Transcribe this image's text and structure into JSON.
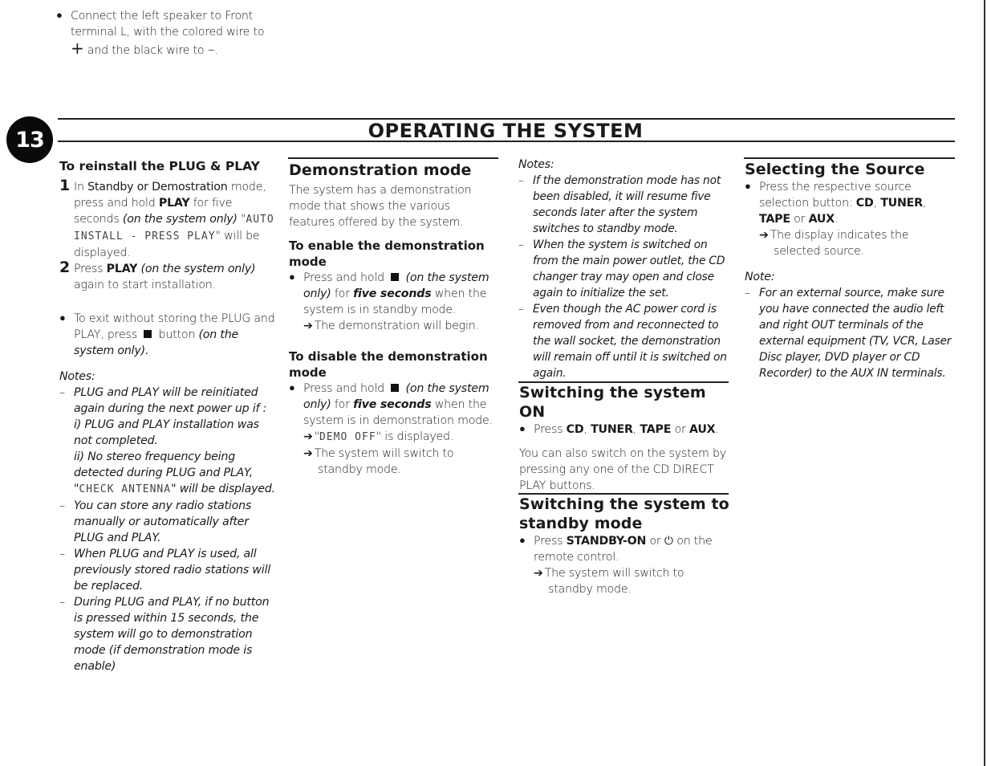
{
  "top_bullet": {
    "line1": "Connect the left speaker to Front",
    "line2": "terminal L, with the colored wire to",
    "plus_symbol": "+",
    "line3_mid": " and the black wire to ",
    "minus_symbol": "–",
    "line3_end": "."
  },
  "section": {
    "number": "13",
    "title": "OPERATING THE SYSTEM"
  },
  "col1": {
    "heading": "To reinstall the PLUG & PLAY",
    "step1": {
      "num": "1",
      "a": "In ",
      "b": "Standby or Demostration",
      "c": " mode, press and hold ",
      "d": "PLAY",
      "e": " for five seconds ",
      "f": "(on the system only)",
      "g": " \"",
      "lcd": "AUTO INSTALL - PRESS PLAY",
      "h": "\" will be displayed."
    },
    "step2": {
      "num": "2",
      "a": "Press ",
      "b": "PLAY",
      "c": " ",
      "d": "(on the system only)",
      "e": " again to start installation."
    },
    "exit_bullet": {
      "a": "To exit without storing the PLUG and PLAY, press ",
      "b": " button ",
      "c": "(on the system only)."
    },
    "notes_label": "Notes:",
    "notes": [
      {
        "a": "PLUG and PLAY will be reinitiated again during the next power up if :",
        "b": "i) PLUG and PLAY installation was not completed.",
        "c": "ii) No stereo frequency being detected during PLUG and PLAY, \"",
        "lcd": "CHECK ANTENNA",
        "d": "\" will be displayed."
      },
      {
        "text": "You can store any radio stations manually or automatically after PLUG and PLAY."
      },
      {
        "text": "When PLUG and PLAY is used, all previously stored radio stations will be replaced."
      },
      {
        "text": "During PLUG and PLAY, if no button is pressed within 15 seconds, the system will go to demonstration mode (if demonstration mode is enable)"
      }
    ]
  },
  "col2": {
    "heading": "Demonstration mode",
    "intro": "The system has a demonstration mode that shows the various features offered by the system.",
    "enable": {
      "heading": "To enable the demonstration mode",
      "a": "Press and hold ",
      "b": "(on the system only)",
      "c": " for ",
      "d": "five seconds",
      "e": " when the system is in standby mode.",
      "result": "The demonstration will begin."
    },
    "disable": {
      "heading": "To disable the demonstration mode",
      "a": "Press and hold ",
      "b": "(on the system only)",
      "c": " for ",
      "d": "five seconds",
      "e": " when the system is in demonstration mode.",
      "result1_a": "\"",
      "result1_lcd": "DEMO OFF",
      "result1_b": "\" is displayed.",
      "result2": "The system will switch to standby mode."
    }
  },
  "col3": {
    "notes_label": "Notes:",
    "notes": [
      "If the demonstration mode has not been disabled, it will resume five seconds later after the system switches to standby mode.",
      "When the system is switched on from the main power outlet, the CD changer tray may open and close again to initialize the set.",
      "Even though the AC power cord is removed from and reconnected to the wall socket, the demonstration will remain off until it is switched on again."
    ],
    "switch_on": {
      "heading": "Switching the system ON",
      "a": "Press ",
      "cd": "CD",
      "sep1": ", ",
      "tuner": "TUNER",
      "sep2": ", ",
      "tape": "TAPE",
      "or": " or ",
      "aux": "AUX",
      "end": ".",
      "para": "You can also switch on the system by pressing any one of the CD DIRECT PLAY buttons."
    },
    "standby": {
      "heading": "Switching the system to standby mode",
      "a": "Press ",
      "b": "STANDBY-ON",
      "c": " or ",
      "power_symbol": "⏻",
      "d": " on the remote control.",
      "result": "The system will switch to standby mode."
    }
  },
  "col4": {
    "heading": "Selecting the Source",
    "a": "Press the respective source selection button: ",
    "cd": "CD",
    "sep1": ", ",
    "tuner": "TUNER",
    "sep2": ", ",
    "tape": "TAPE",
    "or": " or ",
    "aux": "AUX",
    "end": ".",
    "result": "The display indicates the selected source.",
    "note_label": "Note:",
    "note": "For an external source, make sure you have connected the audio left and right OUT terminals of the external equipment (TV, VCR, Laser Disc player, DVD player or CD Recorder) to the AUX IN terminals."
  },
  "arrow_symbol": "➔"
}
